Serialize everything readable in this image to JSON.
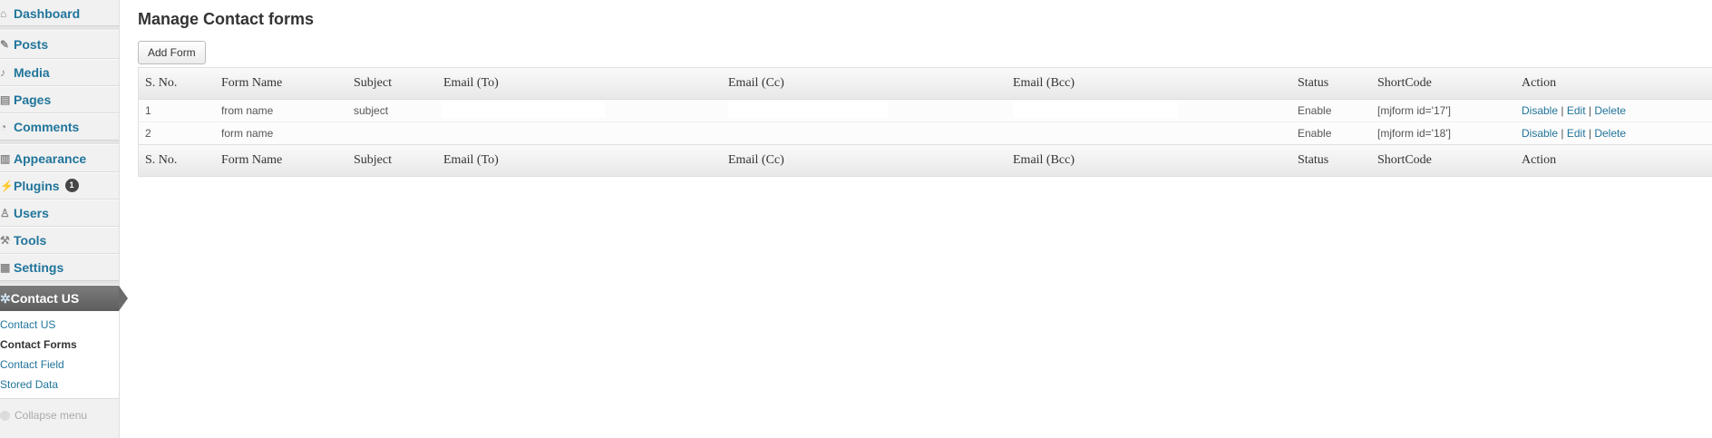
{
  "sidebar": {
    "items": [
      {
        "label": "Dashboard",
        "icon": "dashboard-icon"
      },
      {
        "label": "Posts",
        "icon": "pin-icon"
      },
      {
        "label": "Media",
        "icon": "media-icon"
      },
      {
        "label": "Pages",
        "icon": "pages-icon"
      },
      {
        "label": "Comments",
        "icon": "comments-icon"
      },
      {
        "label": "Appearance",
        "icon": "appearance-icon"
      },
      {
        "label": "Plugins",
        "icon": "plugins-icon",
        "badge": "1"
      },
      {
        "label": "Users",
        "icon": "users-icon"
      },
      {
        "label": "Tools",
        "icon": "tools-icon"
      },
      {
        "label": "Settings",
        "icon": "settings-icon"
      }
    ],
    "active": {
      "label": "Contact US",
      "icon": "gear-icon"
    },
    "submenu": [
      {
        "label": "Contact US"
      },
      {
        "label": "Contact Forms"
      },
      {
        "label": "Contact Field"
      },
      {
        "label": "Stored Data"
      }
    ],
    "collapse_label": "Collapse menu"
  },
  "main": {
    "title": "Manage Contact forms",
    "add_button": "Add Form",
    "table": {
      "columns": [
        "S. No.",
        "Form Name",
        "Subject",
        "Email (To)",
        "Email (Cc)",
        "Email (Bcc)",
        "Status",
        "ShortCode",
        "Action"
      ],
      "rows": [
        {
          "sno": "1",
          "form_name": "from name",
          "subject": "subject",
          "email_to": "",
          "email_cc": "",
          "email_bcc": "",
          "status": "Enable",
          "shortcode": "[mjform id='17']"
        },
        {
          "sno": "2",
          "form_name": "form name",
          "subject": "",
          "email_to": "",
          "email_cc": "",
          "email_bcc": "",
          "status": "Enable",
          "shortcode": "[mjform id='18']"
        }
      ],
      "actions": {
        "disable": "Disable",
        "edit": "Edit",
        "delete": "Delete",
        "separator": "|"
      }
    }
  },
  "colors": {
    "link": "#21759b",
    "active_menu": "#6b6b6b"
  }
}
